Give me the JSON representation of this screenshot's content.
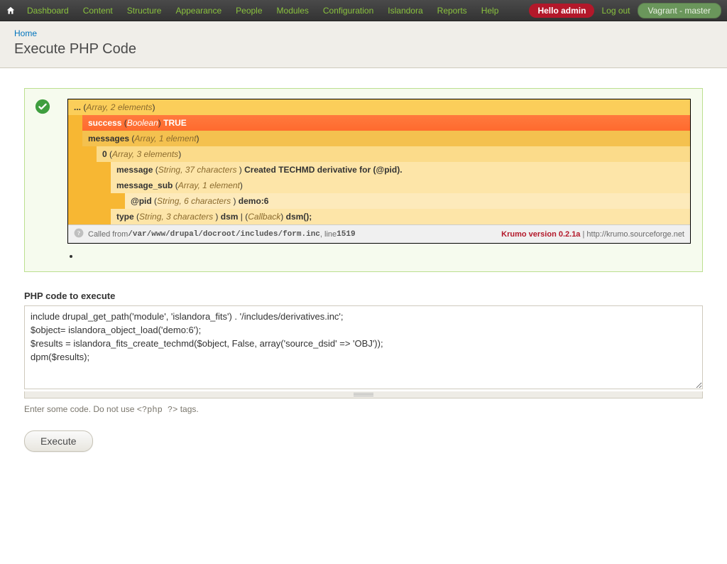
{
  "admin_menu": {
    "items": [
      "Dashboard",
      "Content",
      "Structure",
      "Appearance",
      "People",
      "Modules",
      "Configuration",
      "Islandora",
      "Reports",
      "Help"
    ],
    "hello": "Hello admin",
    "logout": "Log out",
    "env": "Vagrant - master"
  },
  "breadcrumb": {
    "home": "Home"
  },
  "page_title": "Execute PHP Code",
  "krumo": {
    "root_label": "...",
    "root_type": "Array, 2 elements",
    "rows": [
      {
        "indent": 1,
        "cls": "lvl1 hl",
        "key": "success",
        "type": "Boolean",
        "val": "TRUE"
      },
      {
        "indent": 1,
        "cls": "lvl1",
        "key": "messages",
        "type": "Array, 1 element",
        "val": ""
      },
      {
        "indent": 2,
        "cls": "lvl2",
        "key": "0",
        "type": "Array, 3 elements",
        "val": ""
      },
      {
        "indent": 3,
        "cls": "lvl3",
        "key": "message",
        "type": "String, 37 characters ",
        "val": "Created TECHMD derivative for (@pid)."
      },
      {
        "indent": 3,
        "cls": "lvl3",
        "key": "message_sub",
        "type": "Array, 1 element",
        "val": ""
      },
      {
        "indent": 4,
        "cls": "lvl4",
        "key": "@pid",
        "type": "String, 6 characters ",
        "val": "demo:6"
      },
      {
        "indent": 3,
        "cls": "lvl3",
        "key": "type",
        "type": "String, 3 characters ",
        "val": "dsm",
        "extra_type": "Callback",
        "extra_val": "dsm();"
      }
    ],
    "footer": {
      "called_from": "Called from ",
      "path": "/var/www/drupal/docroot/includes/form.inc",
      "line_label": ", line ",
      "line": "1519",
      "version_label": "Krumo version 0.2.1a",
      "sep": " | ",
      "url": "http://krumo.sourceforge.net"
    }
  },
  "form": {
    "label": "PHP code to execute",
    "code": "include drupal_get_path('module', 'islandora_fits') . '/includes/derivatives.inc';\n$object= islandora_object_load('demo:6');\n$results = islandora_fits_create_techmd($object, False, array('source_dsid' => 'OBJ'));\ndpm($results);",
    "desc_pre": "Enter some code. Do not use ",
    "desc_code": "<?php ?>",
    "desc_post": " tags.",
    "submit": "Execute"
  }
}
